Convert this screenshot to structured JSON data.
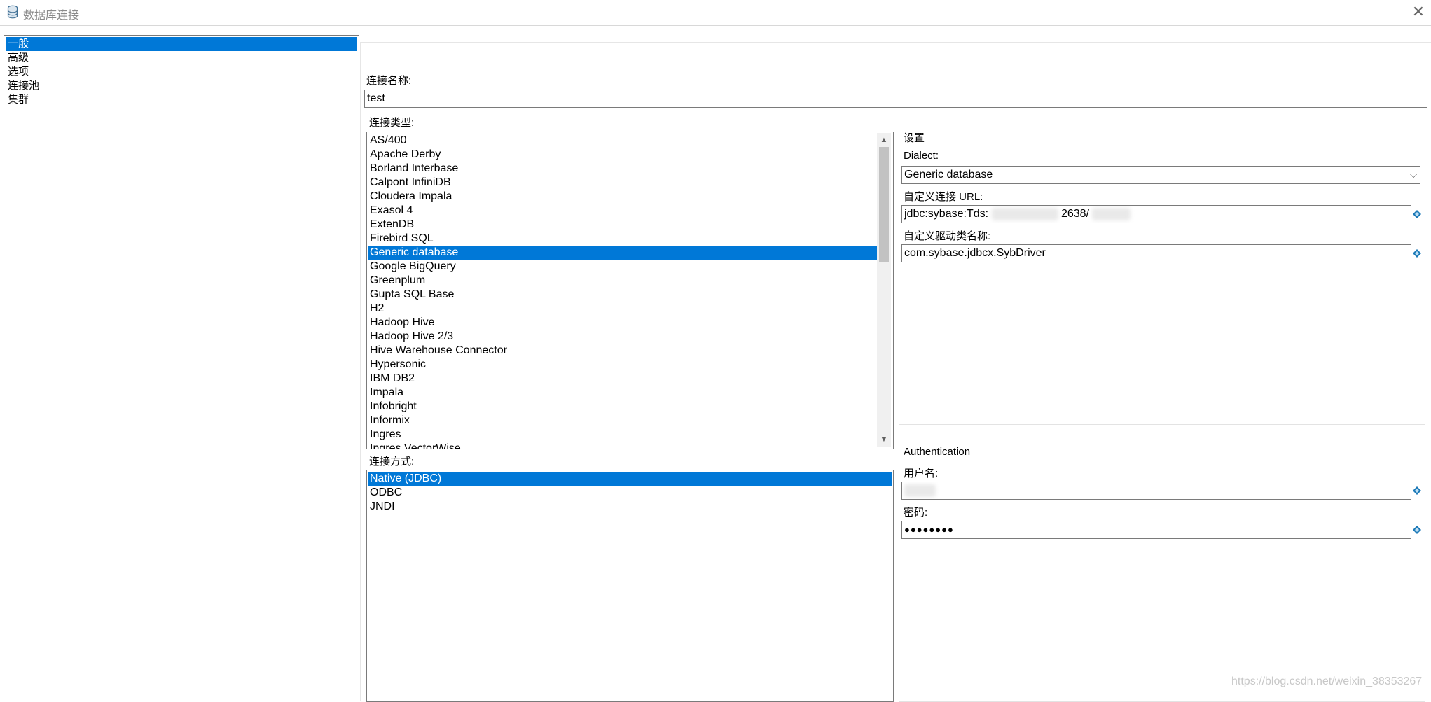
{
  "window": {
    "title": "数据库连接",
    "close_glyph": "✕"
  },
  "nav": {
    "items": [
      "一般",
      "高级",
      "选项",
      "连接池",
      "集群"
    ],
    "selected_index": 0
  },
  "connection_name": {
    "label": "连接名称:",
    "value": "test"
  },
  "connection_type": {
    "label": "连接类型:",
    "items": [
      "AS/400",
      "Apache Derby",
      "Borland Interbase",
      "Calpont InfiniDB",
      "Cloudera Impala",
      "Exasol 4",
      "ExtenDB",
      "Firebird SQL",
      "Generic database",
      "Google BigQuery",
      "Greenplum",
      "Gupta SQL Base",
      "H2",
      "Hadoop Hive",
      "Hadoop Hive 2/3",
      "Hive Warehouse Connector",
      "Hypersonic",
      "IBM DB2",
      "Impala",
      "Infobright",
      "Informix",
      "Ingres",
      "Ingres VectorWise"
    ],
    "selected": "Generic database"
  },
  "access": {
    "label": "连接方式:",
    "items": [
      "Native (JDBC)",
      "ODBC",
      "JNDI"
    ],
    "selected": "Native (JDBC)"
  },
  "settings": {
    "title": "设置",
    "dialect_label": "Dialect:",
    "dialect_value": "Generic database",
    "url_label": "自定义连接 URL:",
    "url_prefix": "jdbc:sybase:Tds:",
    "url_middle": "2638/",
    "driver_label": "自定义驱动类名称:",
    "driver_value": "com.sybase.jdbcx.SybDriver"
  },
  "auth": {
    "title": "Authentication",
    "username_label": "用户名:",
    "password_label": "密码:",
    "password_value": "●●●●●●●●"
  },
  "watermark": "https://blog.csdn.net/weixin_38353267",
  "colors": {
    "selection": "#0078d7",
    "variable_icon": "#1e7bb8"
  }
}
